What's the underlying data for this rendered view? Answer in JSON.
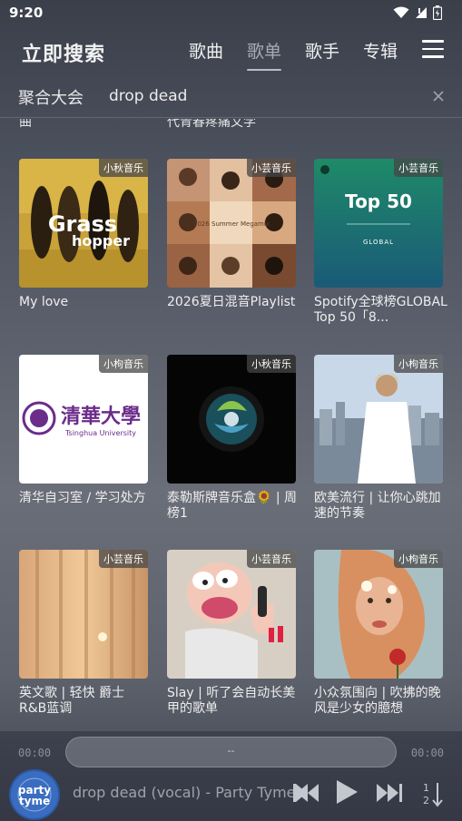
{
  "status_bar": {
    "time": "9:20"
  },
  "header": {
    "title": "立即搜索",
    "tabs": [
      {
        "label": "歌曲",
        "active": false
      },
      {
        "label": "歌单",
        "active": true
      },
      {
        "label": "歌手",
        "active": false
      },
      {
        "label": "专辑",
        "active": false
      }
    ]
  },
  "search": {
    "scope": "聚合大会",
    "query": "drop dead"
  },
  "partial_row": {
    "left": "曲",
    "middle": "代青春疼痛文学"
  },
  "playlists": [
    {
      "title": "My love",
      "source": "小秋音乐"
    },
    {
      "title": "2026夏日混音Playlist",
      "source": "小芸音乐"
    },
    {
      "title": "Spotify全球榜GLOBAL Top 50「8...",
      "source": "小芸音乐"
    },
    {
      "title": "清华自习室 / 学习处方",
      "source": "小枸音乐"
    },
    {
      "title": "泰勒斯牌音乐盒🌻 | 周榜1",
      "source": "小秋音乐"
    },
    {
      "title": "欧美流行 | 让你心跳加速的节奏",
      "source": "小枸音乐"
    },
    {
      "title": "英文歌 | 轻快 爵士 R&B蓝调",
      "source": "小芸音乐"
    },
    {
      "title": "Slay | 听了会自动长美甲的歌单",
      "source": "小芸音乐"
    },
    {
      "title": "小众氛围向 | 吹拂的晚风是少女的臆想",
      "source": "小枸音乐"
    }
  ],
  "covers": {
    "c0_text1": "Grass",
    "c0_text2": "hopper",
    "c1_text": "2026 Summer Megamix",
    "c2_text1": "Top 50",
    "c2_text2": "GLOBAL",
    "c3_text1": "清華大學",
    "c3_text2": "Tsinghua University",
    "now_cover_text1": "party",
    "now_cover_text2": "tyme"
  },
  "player": {
    "time_current": "00:00",
    "time_total": "00:00",
    "progress_label": "--",
    "progress": 0,
    "now_playing": "drop dead (vocal) - Party Tyme"
  },
  "colors": {
    "accent": "#ffffff",
    "badge_bg": "#464646",
    "spotify_green": "#1f8a68"
  }
}
